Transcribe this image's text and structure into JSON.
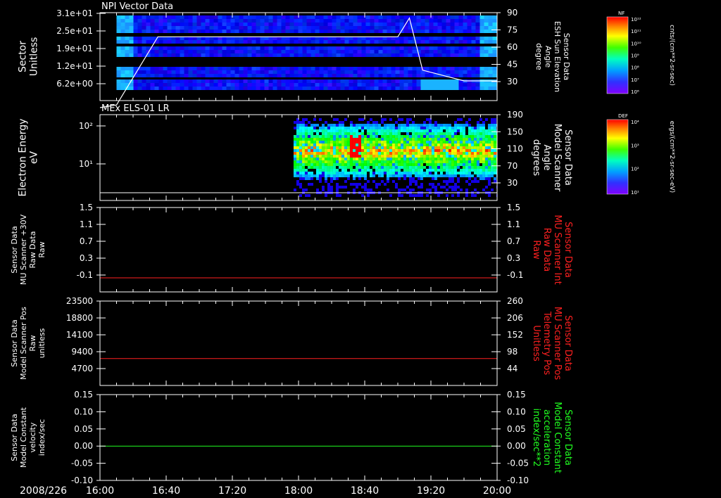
{
  "date_label": "2008/226",
  "time_ticks": [
    "16:00",
    "16:40",
    "17:20",
    "18:00",
    "18:40",
    "19:20",
    "20:00"
  ],
  "colors": {
    "background": "#000000",
    "axes": "#ffffff",
    "red_trace": "#ff2020",
    "green_trace": "#20ff20",
    "right_label_red": "#ff2020",
    "right_label_green": "#20ff20"
  },
  "panels": [
    {
      "title": "NPI Vector Data",
      "left_label": [
        "Sector",
        "Unitless"
      ],
      "left_ticks": [
        "3.1e+01",
        "2.5e+01",
        "1.9e+01",
        "1.2e+01",
        "6.2e+00"
      ],
      "right_label": [
        "Sensor Data",
        "ESH Sun Elevation",
        "Angle",
        "degree"
      ],
      "right_ticks": [
        "90",
        "75",
        "60",
        "45",
        "30"
      ],
      "right_label_color": "white",
      "colorbar": {
        "label": "NF",
        "unit": "cnts/(cm**2-sr-sec)",
        "ticks": [
          "10¹²",
          "10¹¹",
          "10¹⁰",
          "10⁹",
          "10⁸",
          "10⁷",
          "10⁶"
        ]
      }
    },
    {
      "title": "MEx ELS-01 LR",
      "left_label": [
        "Electron Energy",
        "eV"
      ],
      "left_ticks": [
        "10²",
        "10¹"
      ],
      "right_label": [
        "Sensor Data",
        "Model Scanner",
        "Angle",
        "degrees"
      ],
      "right_ticks": [
        "190",
        "150",
        "110",
        "70",
        "30"
      ],
      "right_label_color": "white",
      "colorbar": {
        "label": "DEF",
        "unit": "ergs/(cm**2-sr-sec-eV)",
        "ticks": [
          "10⁴",
          "10³",
          "10²",
          "10¹"
        ]
      }
    },
    {
      "title": "",
      "left_label": [
        "Sensor Data",
        "MU Scanner +30V",
        "Raw Data",
        "Raw"
      ],
      "left_ticks": [
        "1.5",
        "1.1",
        "0.7",
        "0.3",
        "-0.1"
      ],
      "right_label": [
        "Sensor Data",
        "MU Scanner Int",
        "Raw Data",
        "Raw"
      ],
      "right_ticks": [
        "1.5",
        "1.1",
        "0.7",
        "0.3",
        "-0.1"
      ],
      "right_label_color": "red"
    },
    {
      "title": "",
      "left_label": [
        "Sensor Data",
        "Model Scanner Pos",
        "Raw",
        "unitless"
      ],
      "left_ticks": [
        "23500",
        "18800",
        "14100",
        "9400",
        "4700"
      ],
      "right_label": [
        "Sensor Data",
        "MU Scanner Pos",
        "Telemetry Pos",
        "Unitless"
      ],
      "right_ticks": [
        "260",
        "206",
        "152",
        "98",
        "44"
      ],
      "right_label_color": "red"
    },
    {
      "title": "",
      "left_label": [
        "Sensor Data",
        "Model Constant",
        "velocity",
        "index/sec"
      ],
      "left_ticks": [
        "0.15",
        "0.10",
        "0.05",
        "0.00",
        "-0.05",
        "-0.10"
      ],
      "right_label": [
        "Sensor Data",
        "Model Constant",
        "acceleration",
        "index/sec**2"
      ],
      "right_ticks": [
        "0.15",
        "0.10",
        "0.05",
        "0.00",
        "-0.05",
        "-0.10"
      ],
      "right_label_color": "green"
    }
  ],
  "chart_data": [
    {
      "type": "heatmap",
      "title": "NPI Vector Data",
      "x_range": [
        "16:00",
        "20:00"
      ],
      "y_ticks": [
        31,
        25,
        19,
        12,
        6.2
      ],
      "overlay_line": {
        "axis": "right",
        "points": [
          [
            "16:00",
            20
          ],
          [
            "16:10",
            22
          ],
          [
            "16:35",
            73
          ],
          [
            "19:00",
            73
          ],
          [
            "19:07",
            87
          ],
          [
            "19:15",
            48
          ],
          [
            "19:40",
            40
          ],
          [
            "20:00",
            40
          ]
        ]
      }
    },
    {
      "type": "heatmap",
      "title": "MEx ELS-01 LR",
      "x_range": [
        "16:00",
        "20:00"
      ],
      "ylabel": "Electron Energy eV",
      "y_scale": "log",
      "data_start": "17:57",
      "overlay_line": {
        "axis": "right",
        "value": 23
      }
    },
    {
      "type": "line",
      "x_range": [
        "16:00",
        "20:00"
      ],
      "ylim": [
        -0.3,
        1.5
      ],
      "series": [
        {
          "values_constant": 0.0,
          "color": "red"
        }
      ]
    },
    {
      "type": "line",
      "x_range": [
        "16:00",
        "20:00"
      ],
      "ylim": [
        0,
        23500
      ],
      "series": [
        {
          "values_constant": 7500,
          "color": "red"
        }
      ]
    },
    {
      "type": "line",
      "x_range": [
        "16:00",
        "20:00"
      ],
      "ylim": [
        -0.1,
        0.15
      ],
      "series": [
        {
          "values_constant": 0.0,
          "color": "green"
        }
      ]
    }
  ]
}
